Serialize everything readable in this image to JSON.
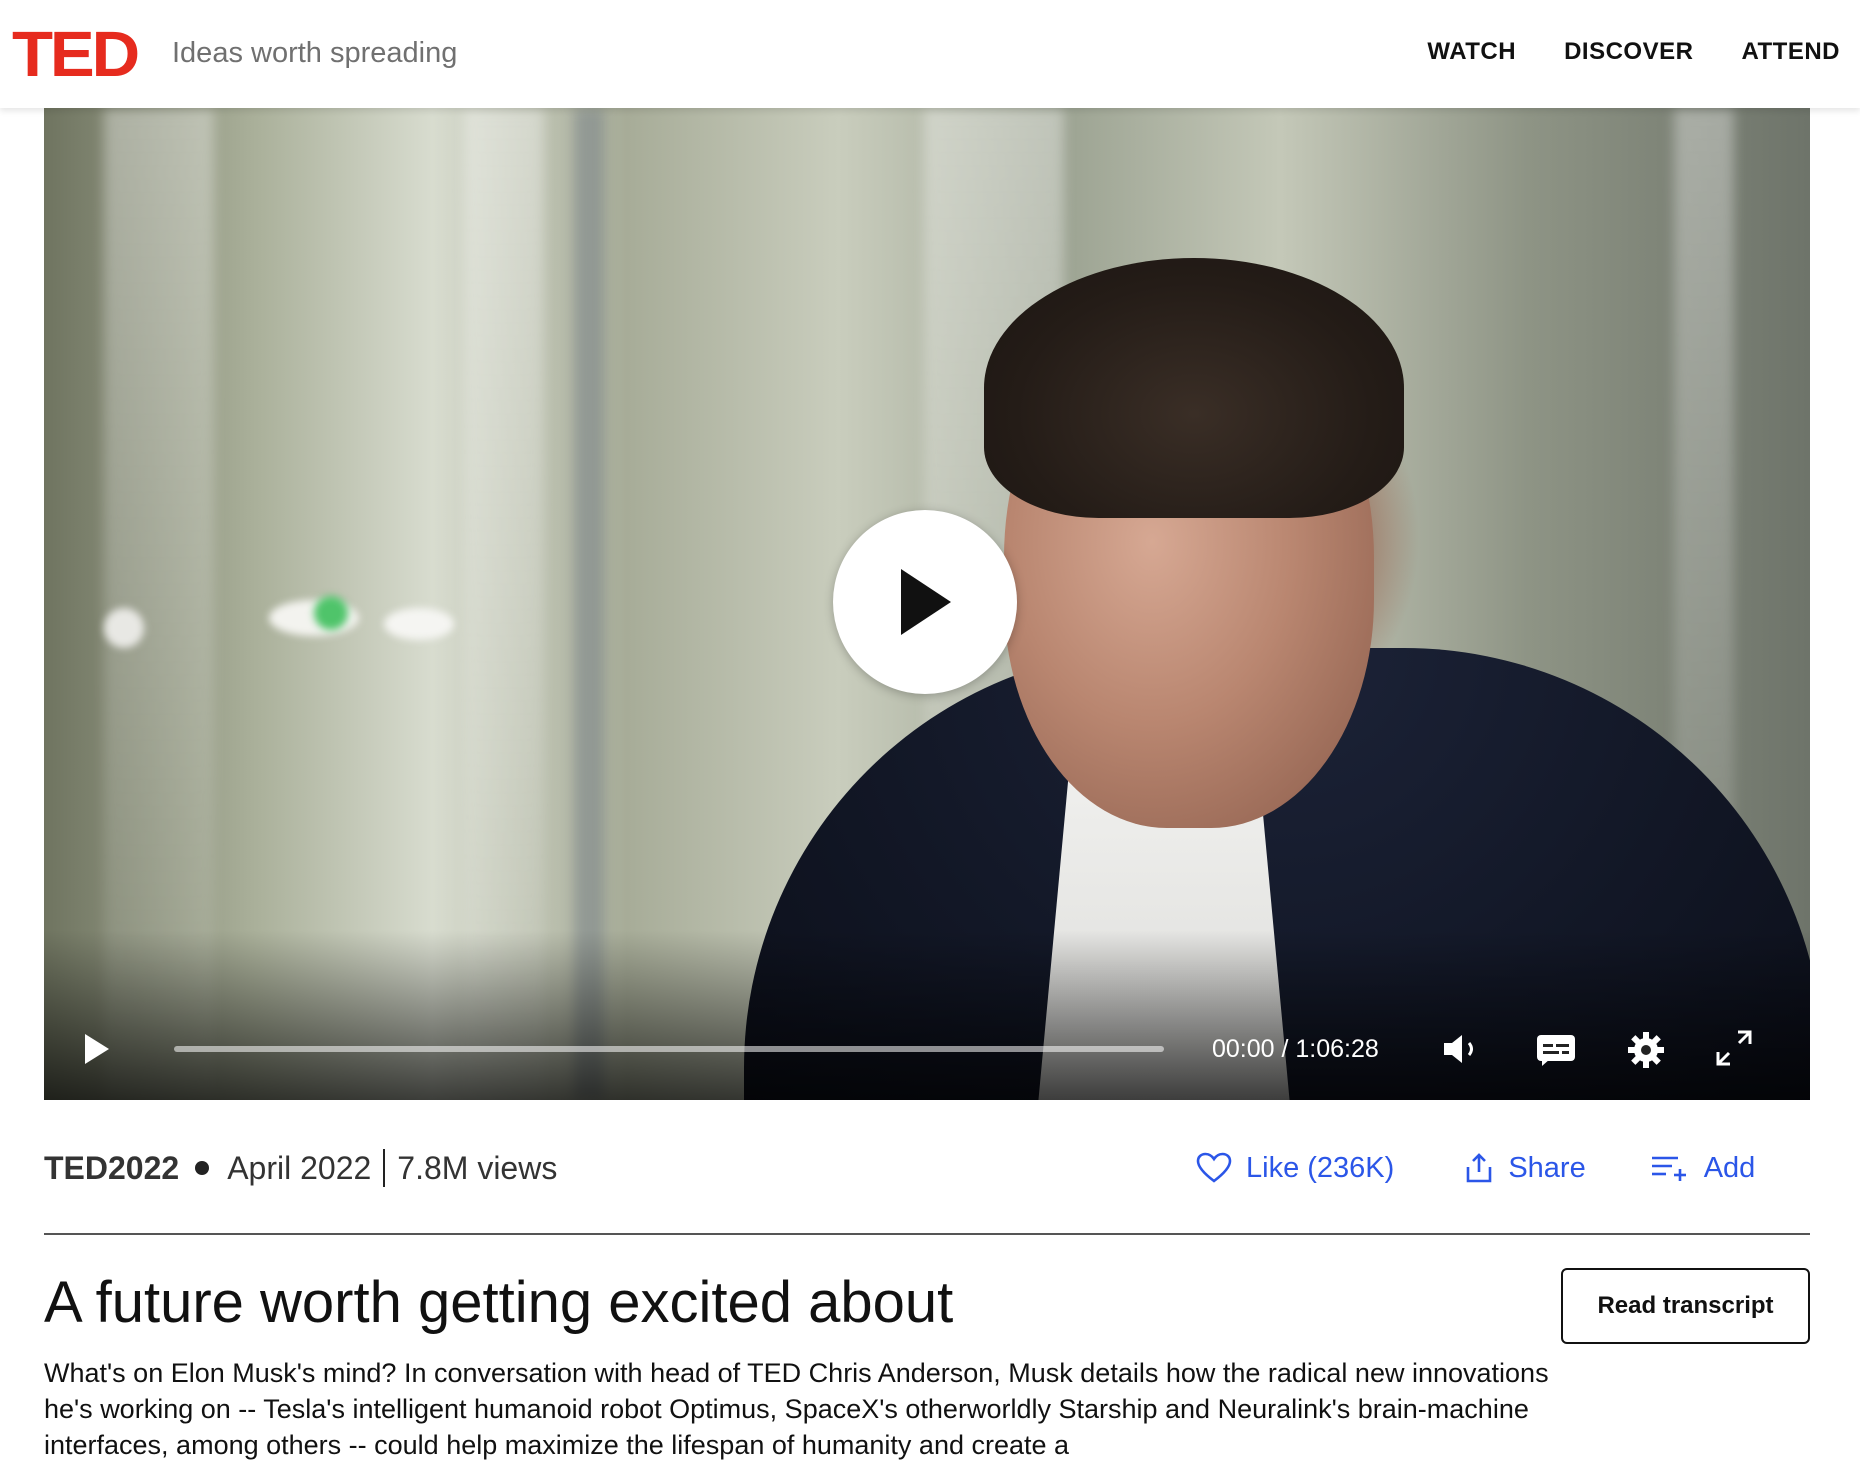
{
  "header": {
    "logo": "TED",
    "tagline": "Ideas worth spreading",
    "nav": [
      "WATCH",
      "DISCOVER",
      "ATTEND"
    ]
  },
  "player": {
    "time_display": "00:00 / 1:06:28",
    "progress_fraction": 0
  },
  "meta": {
    "event": "TED2022",
    "date": "April 2022",
    "views": "7.8M views"
  },
  "actions": {
    "like": "Like (236K)",
    "share": "Share",
    "add": "Add"
  },
  "talk": {
    "title": "A future worth getting excited about",
    "transcript_button": "Read transcript",
    "description": "What's on Elon Musk's mind? In conversation with head of TED Chris Anderson, Musk details how the radical new innovations he's working on -- Tesla's intelligent humanoid robot Optimus, SpaceX's otherworldly Starship and Neuralink's brain-machine interfaces, among others -- could help maximize the lifespan of humanity and create a"
  },
  "colors": {
    "brand_red": "#e62b1e",
    "link_blue": "#2b56e8"
  }
}
